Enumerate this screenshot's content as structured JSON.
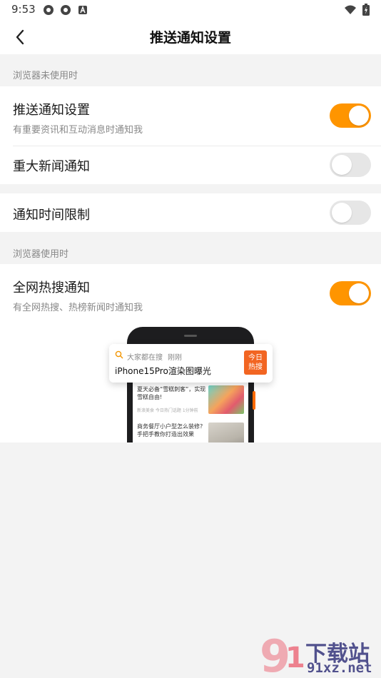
{
  "status_bar": {
    "time": "9:53",
    "left_icons": [
      "settings-gear-icon",
      "settings-gear-icon",
      "a-badge-icon"
    ],
    "right_icons": [
      "wifi-icon",
      "battery-charging-icon"
    ]
  },
  "header": {
    "back_icon": "back-arrow-icon",
    "title": "推送通知设置"
  },
  "sections": {
    "browser_unused": "浏览器未使用时",
    "browser_used": "浏览器使用时"
  },
  "settings": {
    "push_notify": {
      "title": "推送通知设置",
      "subtitle": "有重要资讯和互动消息时通知我",
      "enabled": true
    },
    "major_news": {
      "title": "重大新闻通知",
      "enabled": false
    },
    "time_limit": {
      "title": "通知时间限制",
      "enabled": false
    },
    "hot_search": {
      "title": "全网热搜通知",
      "subtitle": "有全网热搜、热榜新闻时通知我",
      "enabled": true
    }
  },
  "illustration": {
    "notification": {
      "source": "大家都在搜",
      "time": "刚刚",
      "headline": "iPhone15Pro渲染图曝光",
      "badge_line1": "今日",
      "badge_line2": "热搜"
    },
    "news": [
      {
        "title": "夏天必备“雪糕刺客”，实现雪糕自由!",
        "meta": "新浪美食  今日热门话题  1分钟前"
      },
      {
        "title": "商务餐厅小户型怎么装修? 手把手教你打造出效果",
        "meta": ""
      }
    ]
  },
  "watermark": {
    "brand": "下载站",
    "url": "91xz.net"
  },
  "colors": {
    "accent": "#ff9500",
    "toggle_off": "#e6e6e6",
    "badge": "#f26522",
    "background": "#f3f3f3"
  }
}
